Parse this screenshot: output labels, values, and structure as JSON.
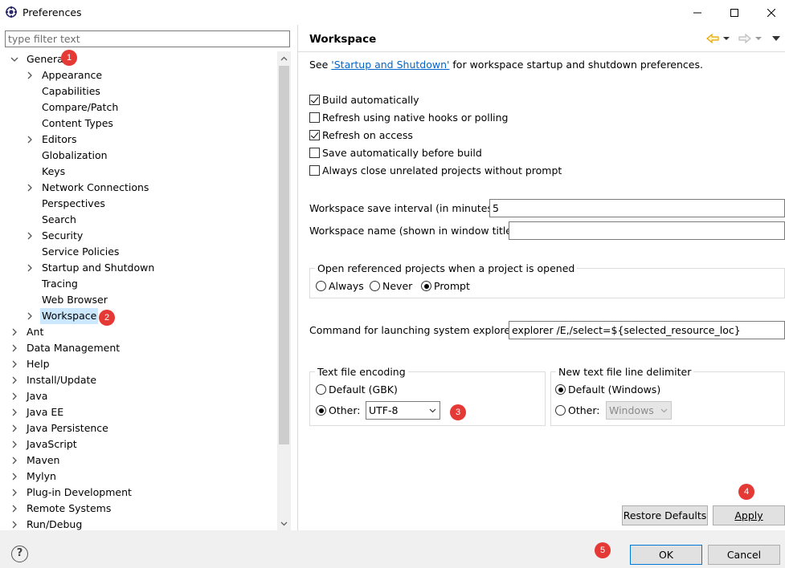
{
  "window": {
    "title": "Preferences"
  },
  "filter": {
    "placeholder": "type filter text"
  },
  "tree": {
    "general": "General",
    "general_children": [
      "Appearance",
      "Capabilities",
      "Compare/Patch",
      "Content Types",
      "Editors",
      "Globalization",
      "Keys",
      "Network Connections",
      "Perspectives",
      "Search",
      "Security",
      "Service Policies",
      "Startup and Shutdown",
      "Tracing",
      "Web Browser",
      "Workspace"
    ],
    "top_level": [
      "Ant",
      "Data Management",
      "Help",
      "Install/Update",
      "Java",
      "Java EE",
      "Java Persistence",
      "JavaScript",
      "Maven",
      "Mylyn",
      "Plug-in Development",
      "Remote Systems",
      "Run/Debug"
    ]
  },
  "badges": [
    "1",
    "2",
    "3",
    "4",
    "5"
  ],
  "page": {
    "title": "Workspace",
    "intro_prefix": "See ",
    "intro_link": "'Startup and Shutdown'",
    "intro_suffix": " for workspace startup and shutdown preferences.",
    "checkboxes": {
      "build_auto": "Build automatically",
      "refresh_native": "Refresh using native hooks or polling",
      "refresh_access": "Refresh on access",
      "save_auto": "Save automatically before build",
      "always_close": "Always close unrelated projects without prompt"
    },
    "save_interval_label": "Workspace save interval (in minutes):",
    "save_interval_value": "5",
    "ws_name_label": "Workspace name (shown in window title):",
    "ws_name_value": "",
    "open_ref_group": "Open referenced projects when a project is opened",
    "open_ref_options": {
      "always": "Always",
      "never": "Never",
      "prompt": "Prompt"
    },
    "explorer_label": "Command for launching system explorer:",
    "explorer_value": "explorer /E,/select=${selected_resource_loc}",
    "encoding_group": "Text file encoding",
    "encoding_default": "Default (GBK)",
    "encoding_other": "Other:",
    "encoding_value": "UTF-8",
    "delimiter_group": "New text file line delimiter",
    "delimiter_default": "Default (Windows)",
    "delimiter_other": "Other:",
    "delimiter_value": "Windows",
    "restore_defaults": "Restore Defaults",
    "apply": "Apply"
  },
  "footer": {
    "ok": "OK",
    "cancel": "Cancel",
    "help": "?"
  },
  "colors": {
    "badge": "#e53935",
    "selection": "#cce8ff",
    "link": "#0066cc",
    "nav_arrow": "#e8a500"
  },
  "icons": [
    "app-icon",
    "minimize-icon",
    "maximize-icon",
    "close-icon",
    "back-arrow-icon",
    "forward-arrow-icon",
    "view-menu-icon",
    "help-icon",
    "expand-chevron-icon",
    "collapse-chevron-icon",
    "scroll-up-icon",
    "scroll-down-icon",
    "dropdown-icon"
  ]
}
